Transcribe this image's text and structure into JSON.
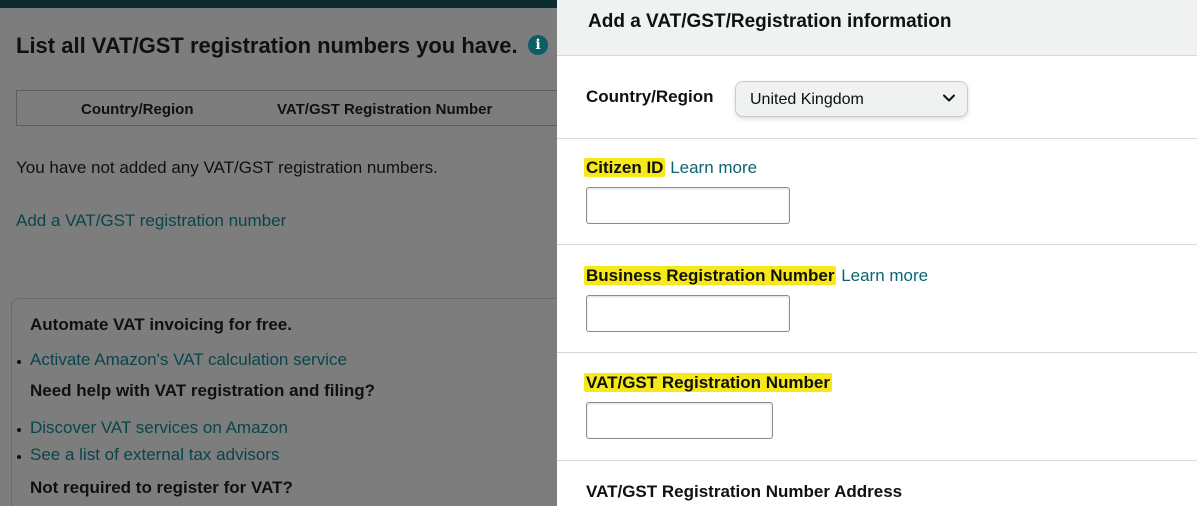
{
  "background_page": {
    "title": "List all VAT/GST registration numbers you have.",
    "info_icon_glyph": "i",
    "table": {
      "headers": [
        "Country/Region",
        "VAT/GST Registration Number"
      ]
    },
    "empty_message": "You have not added any VAT/GST registration numbers.",
    "add_link": "Add a VAT/GST registration number",
    "help": {
      "heading_1": "Automate VAT invoicing for free.",
      "link_1": "Activate Amazon's VAT calculation service",
      "heading_2": "Need help with VAT registration and filing?",
      "link_2": "Discover VAT services on Amazon",
      "link_3": "See a list of external tax advisors",
      "heading_3": "Not required to register for VAT?"
    }
  },
  "modal": {
    "title": "Add a VAT/GST/Registration information",
    "country": {
      "label": "Country/Region",
      "selected": "United Kingdom"
    },
    "fields": {
      "citizen_id": {
        "label": "Citizen ID",
        "learn_more": "Learn more",
        "value": ""
      },
      "business_reg": {
        "label": "Business Registration Number",
        "learn_more": "Learn more",
        "value": ""
      },
      "vat_number": {
        "label": "VAT/GST Registration Number",
        "value": ""
      }
    },
    "address_label": "VAT/GST Registration Number Address"
  },
  "colors": {
    "highlight": "#f7e81a",
    "link": "#0a6572",
    "overlay_bg": "#7d7d7d",
    "header_bar": "#0c2c2f"
  }
}
